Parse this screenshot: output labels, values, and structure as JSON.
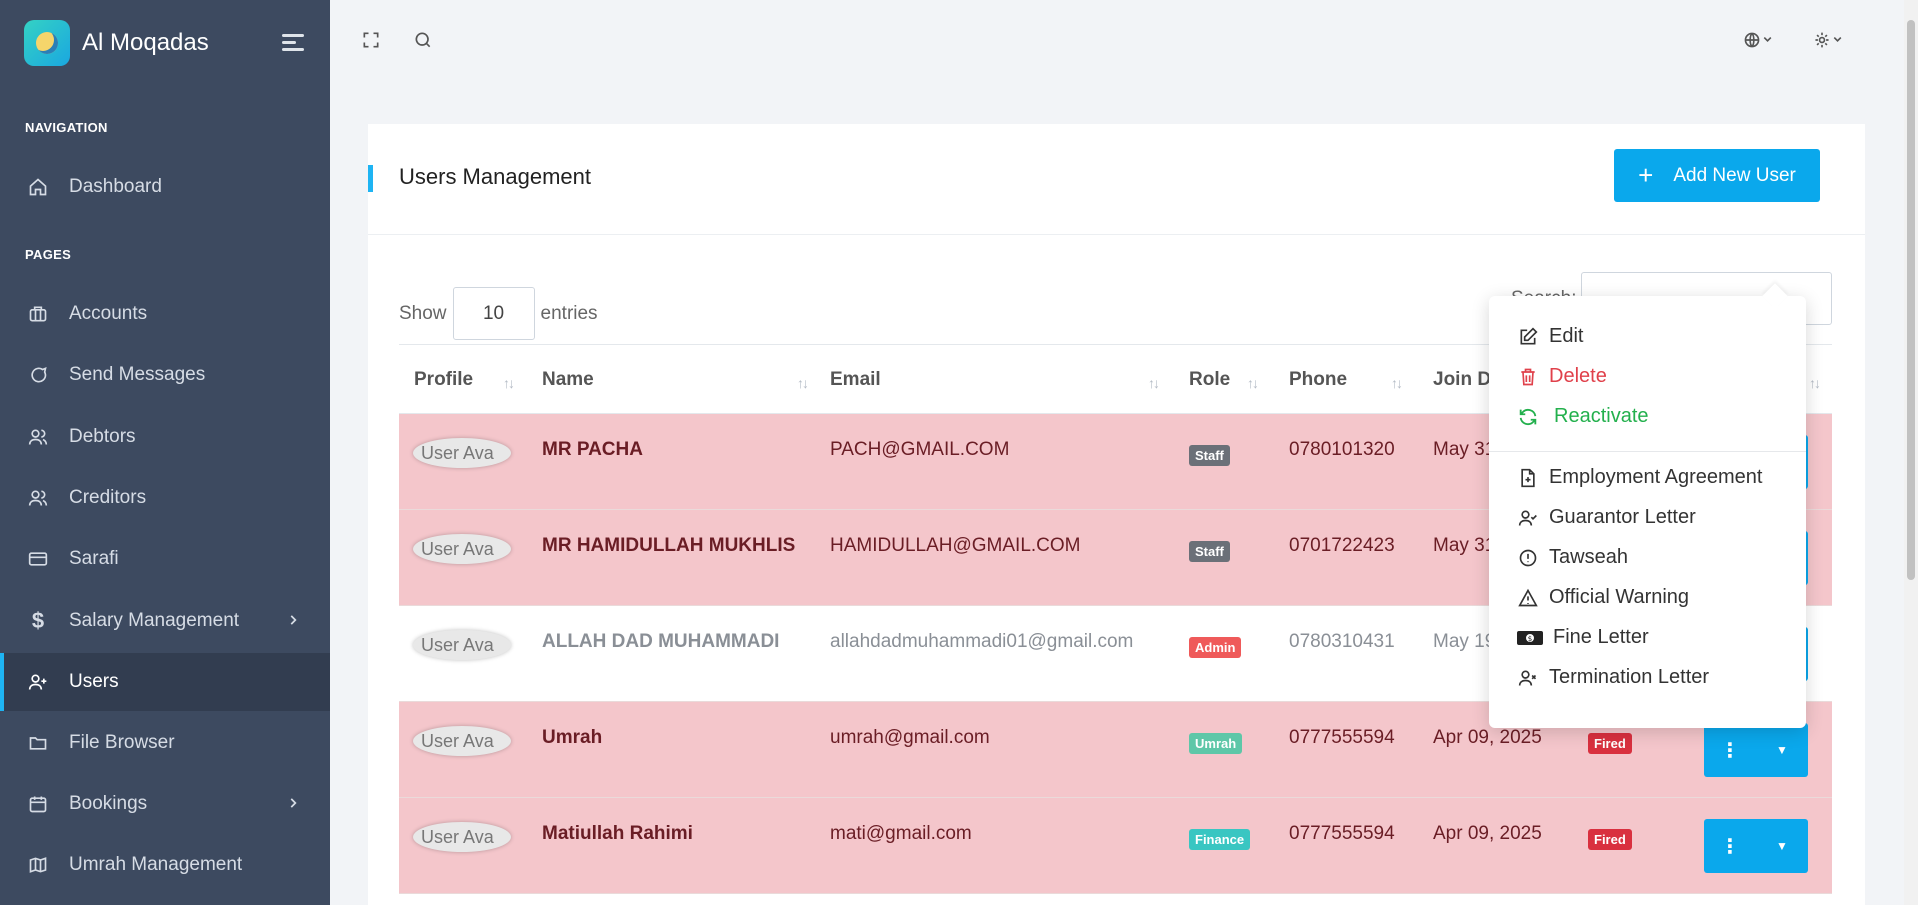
{
  "app": {
    "name": "Al Moqadas"
  },
  "sidebar": {
    "section_navigation": "NAVIGATION",
    "section_pages": "PAGES",
    "items": [
      {
        "label": "Dashboard",
        "icon": "home-icon"
      },
      {
        "label": "Accounts",
        "icon": "briefcase-icon"
      },
      {
        "label": "Send Messages",
        "icon": "message-icon"
      },
      {
        "label": "Debtors",
        "icon": "users-icon"
      },
      {
        "label": "Creditors",
        "icon": "users-icon"
      },
      {
        "label": "Sarafi",
        "icon": "card-icon"
      },
      {
        "label": "Salary Management",
        "icon": "dollar-icon"
      },
      {
        "label": "Users",
        "icon": "user-plus-icon"
      },
      {
        "label": "File Browser",
        "icon": "folder-icon"
      },
      {
        "label": "Bookings",
        "icon": "calendar-icon"
      },
      {
        "label": "Umrah Management",
        "icon": "map-icon"
      }
    ]
  },
  "page": {
    "title": "Users Management",
    "add_button": "Add New User",
    "show_label": "Show",
    "entries_value": "10",
    "entries_label": "entries",
    "search_label": "Search:"
  },
  "table": {
    "headers": [
      "Profile",
      "Name",
      "Email",
      "Role",
      "Phone",
      "Join Da"
    ],
    "avatar_alt": "User Ava",
    "rows": [
      {
        "name": "MR PACHA",
        "email": "PACH@GMAIL.COM",
        "role": "Staff",
        "phone": "0780101320",
        "date": "May 31"
      },
      {
        "name": "MR HAMIDULLAH MUKHLIS",
        "email": "HAMIDULLAH@GMAIL.COM",
        "role": "Staff",
        "phone": "0701722423",
        "date": "May 31"
      },
      {
        "name": "ALLAH DAD MUHAMMADI",
        "email": "allahdadmuhammadi01@gmail.com",
        "role": "Admin",
        "phone": "0780310431",
        "date": "May 19"
      },
      {
        "name": "Umrah",
        "email": "umrah@gmail.com",
        "role": "Umrah",
        "phone": "0777555594",
        "date": "Apr 09, 2025",
        "status": "Fired"
      },
      {
        "name": "Matiullah Rahimi",
        "email": "mati@gmail.com",
        "role": "Finance",
        "phone": "0777555594",
        "date": "Apr 09, 2025",
        "status": "Fired"
      }
    ]
  },
  "dropdown": {
    "items": [
      {
        "label": "Edit",
        "icon": "edit-icon"
      },
      {
        "label": "Delete",
        "icon": "trash-icon"
      },
      {
        "label": "Reactivate",
        "icon": "refresh-icon"
      },
      {
        "label": "Employment Agreement",
        "icon": "file-plus-icon"
      },
      {
        "label": "Guarantor Letter",
        "icon": "user-check-icon"
      },
      {
        "label": "Tawseah",
        "icon": "alert-circle-icon"
      },
      {
        "label": "Official Warning",
        "icon": "warning-triangle-icon"
      },
      {
        "label": "Fine Letter",
        "icon": "banknote-icon"
      },
      {
        "label": "Termination Letter",
        "icon": "user-x-icon"
      }
    ]
  },
  "colors": {
    "sidebar": "#3d4a60",
    "accent": "#0aa8ec",
    "fired_row": "#f4c6cb",
    "danger": "#d9303f",
    "success": "#23b04d"
  }
}
